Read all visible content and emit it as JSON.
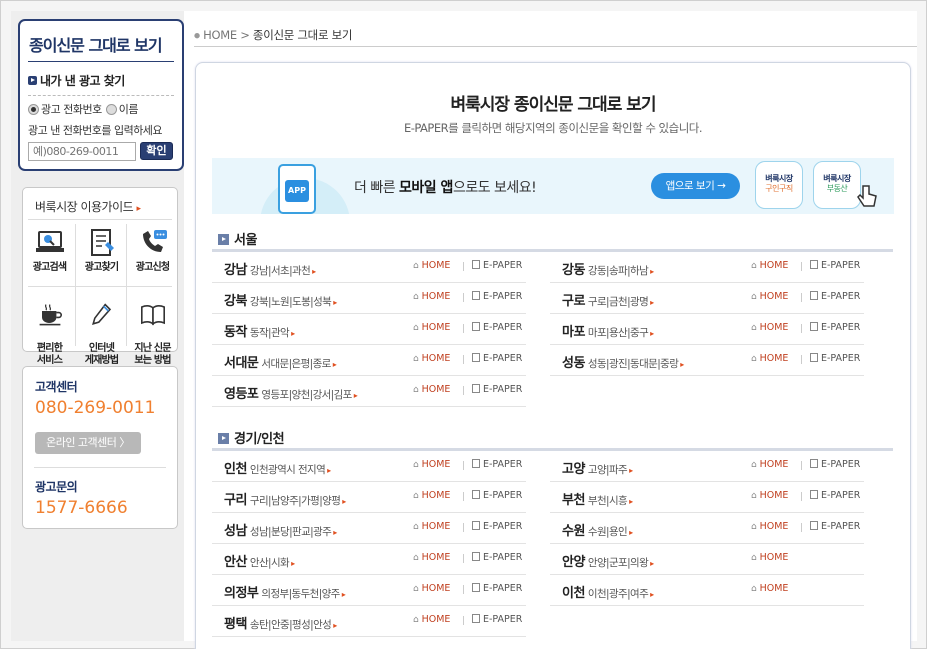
{
  "left": {
    "paper_title": "종이신문 그대로 보기",
    "find_ad_title": "내가 낸 광고 찾기",
    "radio_phone": "광고 전화번호",
    "radio_name": "이름",
    "hint": "광고 낸 전화번호를 입력하세요",
    "phone_placeholder": "예)080-269-0011",
    "ok_label": "확인",
    "guide_title": "벼룩시장 이용가이드",
    "guide_arrow": "▸",
    "guide_items": [
      {
        "label": "광고검색",
        "icon": "computer-search-icon"
      },
      {
        "label": "광고찾기",
        "icon": "document-edit-icon"
      },
      {
        "label": "광고신청",
        "icon": "phone-chat-icon"
      },
      {
        "label": "편리한\n서비스",
        "icon": "coffee-cup-icon"
      },
      {
        "label": "인터넷\n게재방법",
        "icon": "pencil-icon"
      },
      {
        "label": "지난 신문\n보는 방법",
        "icon": "open-book-icon"
      }
    ],
    "cs_label": "고객센터",
    "cs_number": "080-269-0011",
    "cs_button": "온라인 고객센터 〉",
    "ad_label": "광고문의",
    "ad_number": "1577-6666"
  },
  "breadcrumb": {
    "home": "HOME",
    "sep": ">",
    "current": "종이신문 그대로 보기"
  },
  "panel": {
    "title": "벼룩시장 종이신문 그대로 보기",
    "subtitle": "E-PAPER를 클릭하면 해당지역의 종이신문을 확인할 수 있습니다.",
    "banner": {
      "app_icon": "APP",
      "text_pre": "더 빠른 ",
      "text_bold": "모바일 앱",
      "text_post": "으로도 보세요!",
      "app_button": "앱으로 보기 →",
      "card1_title": "벼룩시장",
      "card1_sub": "구인구직",
      "card2_title": "벼룩시장",
      "card2_sub": "부동산"
    },
    "home_label": "HOME",
    "epaper_label": "E-PAPER",
    "sections": [
      {
        "title": "서울",
        "rows": [
          [
            {
              "name": "강남",
              "sub": "강남|서초|과천"
            },
            {
              "name": "강동",
              "sub": "강동|송파|하남"
            }
          ],
          [
            {
              "name": "강북",
              "sub": "강북|노원|도봉|성북"
            },
            {
              "name": "구로",
              "sub": "구로|금천|광명"
            }
          ],
          [
            {
              "name": "동작",
              "sub": "동작|관악"
            },
            {
              "name": "마포",
              "sub": "마포|용산|중구"
            }
          ],
          [
            {
              "name": "서대문",
              "sub": "서대문|은평|종로"
            },
            {
              "name": "성동",
              "sub": "성동|광진|동대문|중랑"
            }
          ],
          [
            {
              "name": "영등포",
              "sub": "영등포|양천|강서|김포"
            },
            null
          ]
        ]
      },
      {
        "title": "경기/인천",
        "rows": [
          [
            {
              "name": "인천",
              "sub": "인천광역시 전지역"
            },
            {
              "name": "고양",
              "sub": "고양|파주"
            }
          ],
          [
            {
              "name": "구리",
              "sub": "구리|남양주|가평|양평"
            },
            {
              "name": "부천",
              "sub": "부천|시흥"
            }
          ],
          [
            {
              "name": "성남",
              "sub": "성남|분당|판교|광주"
            },
            {
              "name": "수원",
              "sub": "수원|용인"
            }
          ],
          [
            {
              "name": "안산",
              "sub": "안산|시화"
            },
            {
              "name": "안양",
              "sub": "안양|군포|의왕"
            }
          ],
          [
            {
              "name": "의정부",
              "sub": "의정부|동두천|양주"
            },
            {
              "name": "이천",
              "sub": "이천|광주|여주"
            }
          ],
          [
            {
              "name": "평택",
              "sub": "송탄|안중|평성|안성"
            },
            null
          ]
        ]
      }
    ],
    "no_epaper": [
      "안양",
      "이천"
    ]
  }
}
